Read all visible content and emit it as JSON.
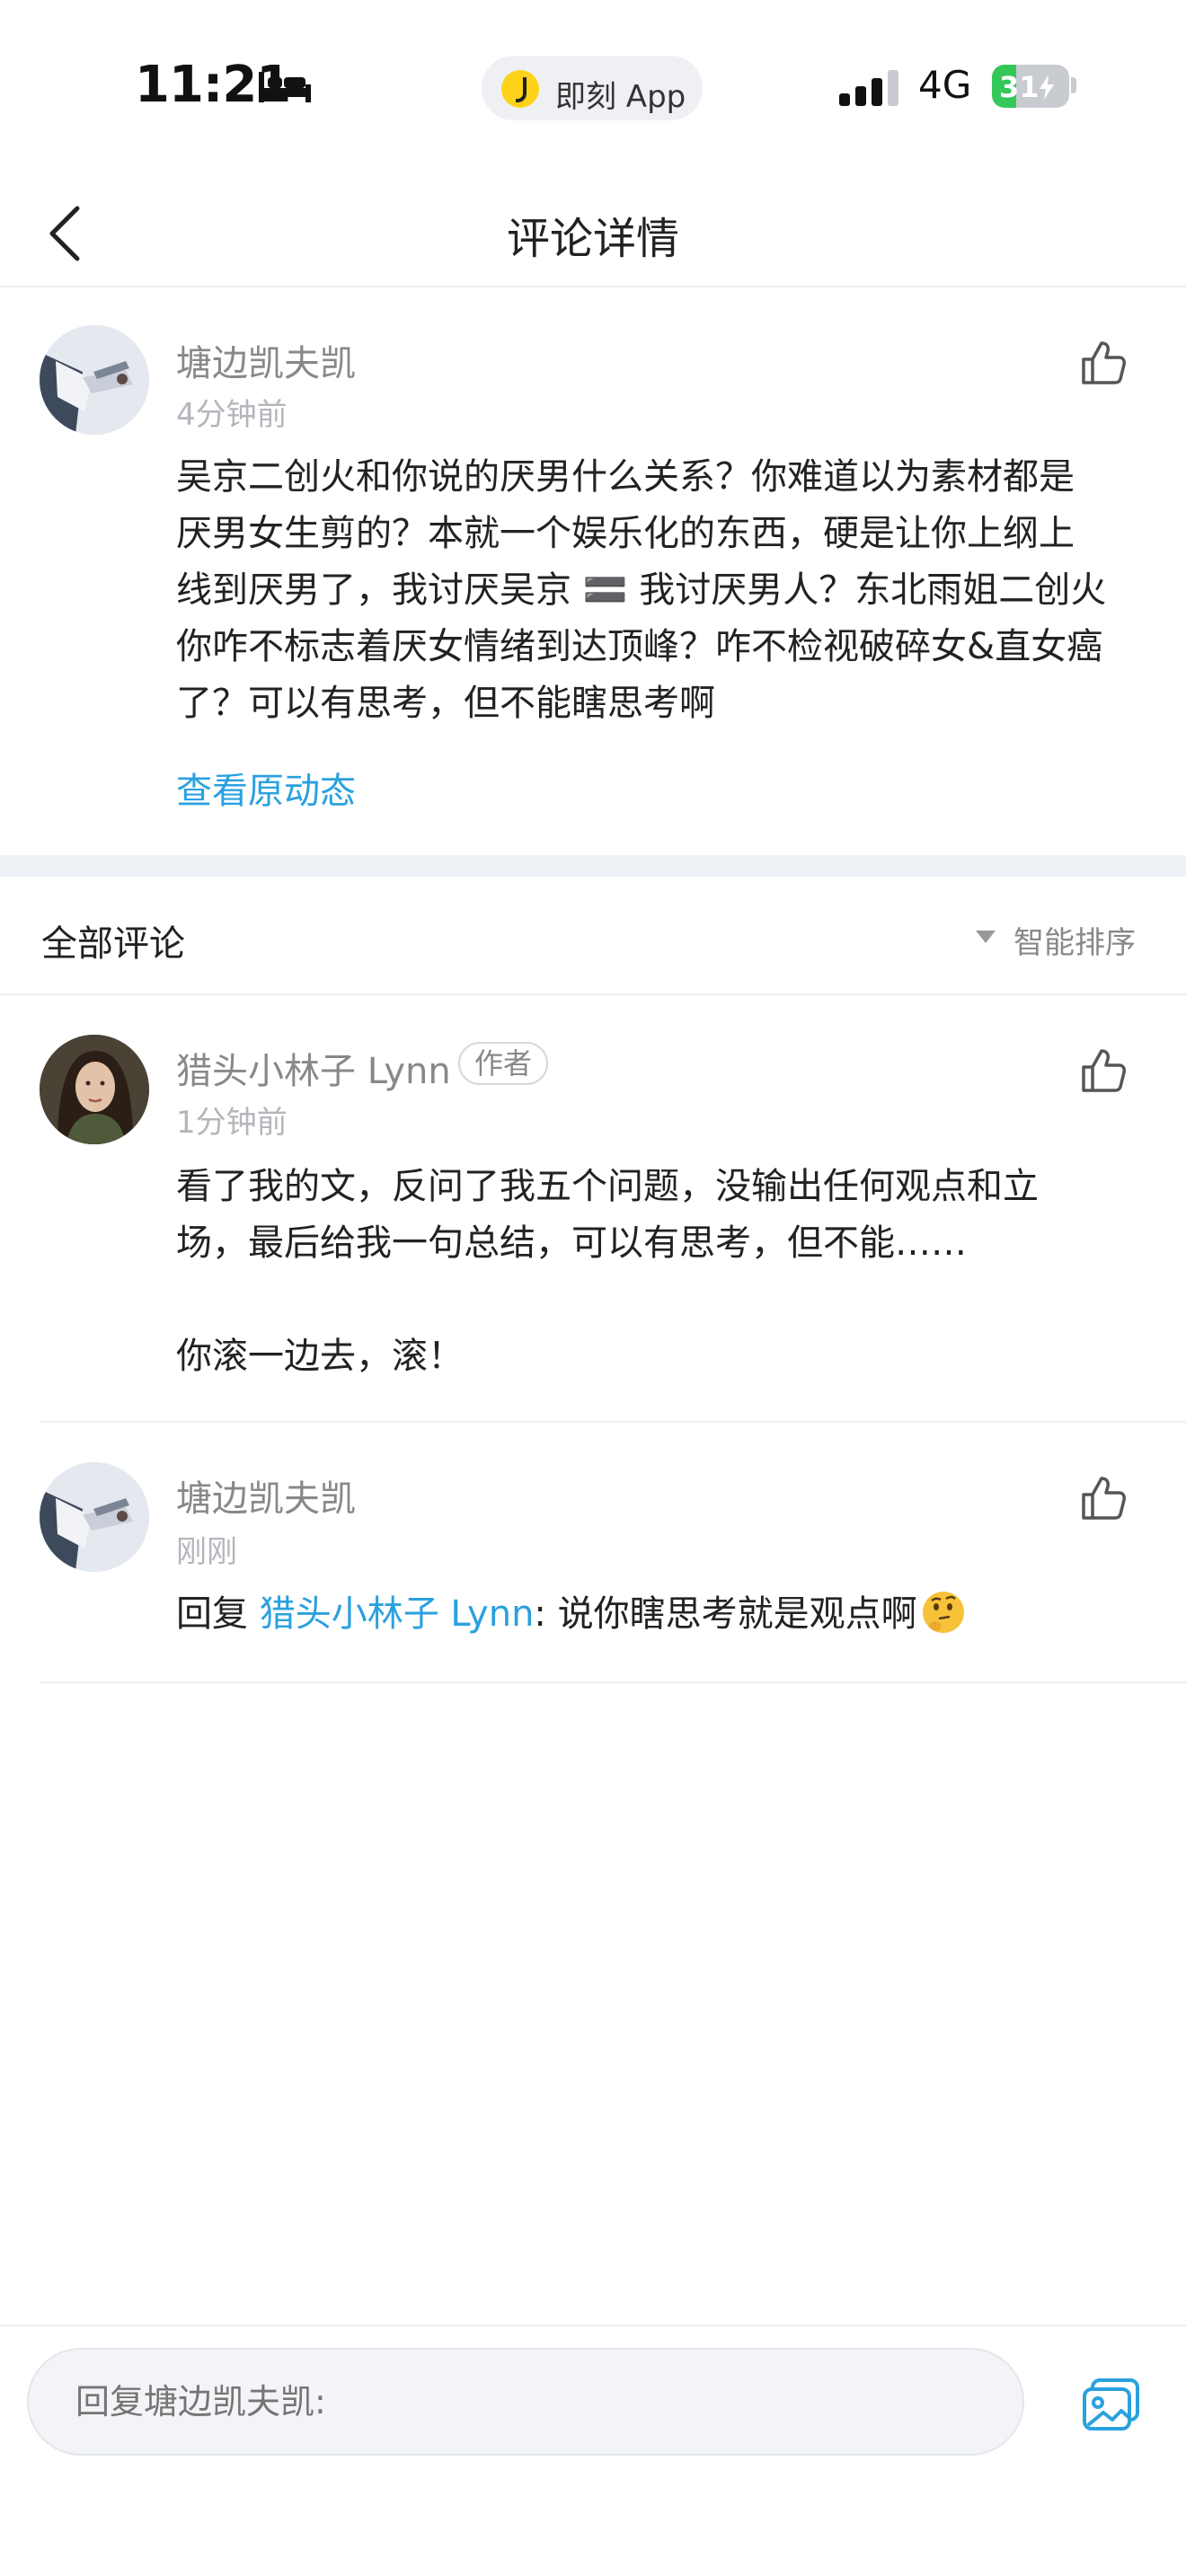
{
  "status_bar": {
    "time": "11:21",
    "app_pill_label": "即刻 App",
    "network": "4G",
    "battery_level": "31",
    "battery_fraction": 0.31
  },
  "header": {
    "title": "评论详情",
    "back_icon": "chevron-left-icon"
  },
  "main_comment": {
    "author": "塘边凯夫凯",
    "time": "4分钟前",
    "lines": [
      "吴京二创火和你说的厌男什么关系？你难道以为素材都是",
      "厌男女生剪的？本就一个娱乐化的东西，硬是让你上纲上",
      "线到厌男了，我讨厌吴京 🟰 我讨厌男人？东北雨姐二创火",
      "你咋不标志着厌女情绪到达顶峰？咋不检视破碎女&直女癌",
      "了？可以有思考，但不能瞎思考啊"
    ],
    "view_original": "查看原动态"
  },
  "section": {
    "title": "全部评论",
    "sort_label": "智能排序"
  },
  "replies": [
    {
      "author": "猎头小林子 Lynn",
      "badge": "作者",
      "time": "1分钟前",
      "lines": [
        "看了我的文，反问了我五个问题，没输出任何观点和立",
        "场，最后给我一句总结，可以有思考，但不能……",
        "",
        "你滚一边去，滚！"
      ]
    },
    {
      "author": "塘边凯夫凯",
      "time": "刚刚",
      "reply_prefix": "回复 ",
      "mention": "猎头小林子 Lynn",
      "reply_text": ": 说你瞎思考就是观点啊",
      "emoji": "thinking-face-icon"
    }
  ],
  "reply_bar": {
    "placeholder": "回复塘边凯夫凯:",
    "image_icon": "image-upload-icon"
  },
  "colors": {
    "accent": "#2aa1df",
    "secondary_text": "#888888",
    "section_gap": "#eef1f5",
    "battery_green": "#34c759"
  }
}
